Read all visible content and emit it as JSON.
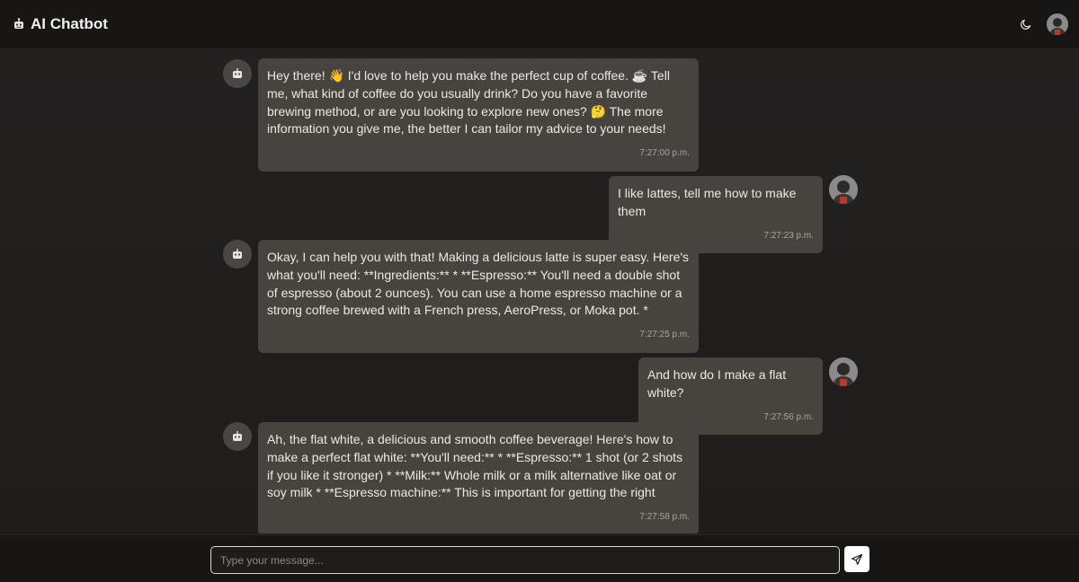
{
  "app": {
    "title": "AI Chatbot",
    "logo_icon": "robot-icon",
    "theme_toggle_icon": "moon-icon",
    "user_avatar": "user-avatar"
  },
  "messages": [
    {
      "sender": "bot",
      "text": "Hey there! 👋 I'd love to help you make the perfect cup of coffee. ☕ Tell me, what kind of coffee do you usually drink? Do you have a favorite brewing method, or are you looking to explore new ones? 🤔 The more information you give me, the better I can tailor my advice to your needs!",
      "time": "7:27:00 p.m."
    },
    {
      "sender": "user",
      "text": "I like lattes, tell me how to make them",
      "time": "7:27:23 p.m."
    },
    {
      "sender": "bot",
      "text": "Okay, I can help you with that! Making a delicious latte is super easy. Here's what you'll need: **Ingredients:** * **Espresso:** You'll need a double shot of espresso (about 2 ounces). You can use a home espresso machine or a strong coffee brewed with a French press, AeroPress, or Moka pot. *",
      "time": "7:27:25 p.m."
    },
    {
      "sender": "user",
      "text": "And how do I make a flat white?",
      "time": "7:27:56 p.m."
    },
    {
      "sender": "bot",
      "text": "Ah, the flat white, a delicious and smooth coffee beverage! Here's how to make a perfect flat white: **You'll need:** * **Espresso:** 1 shot (or 2 shots if you like it stronger) * **Milk:** Whole milk or a milk alternative like oat or soy milk * **Espresso machine:** This is important for getting the right",
      "time": "7:27:58 p.m."
    }
  ],
  "composer": {
    "placeholder": "Type your message...",
    "value": "",
    "send_icon": "send-icon"
  },
  "colors": {
    "background": "#1d1b19",
    "bubble": "#47443f",
    "header": "#181614",
    "send_button": "#ffffff"
  }
}
